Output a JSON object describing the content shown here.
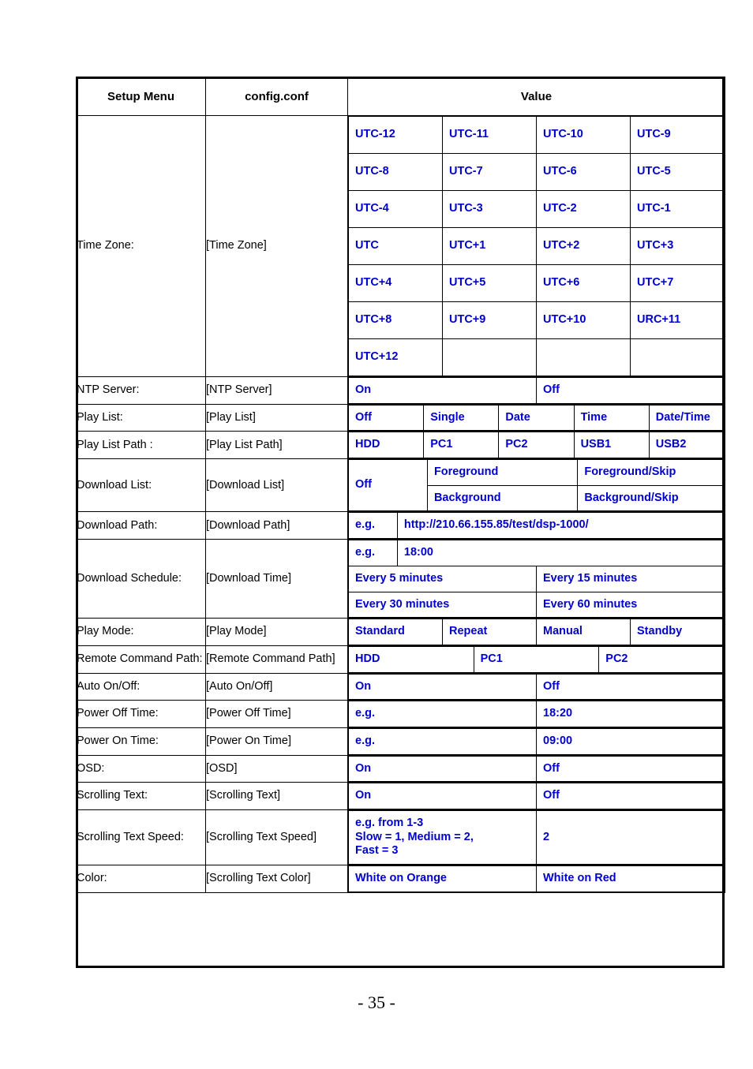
{
  "page": {
    "footer": "- 35 -"
  },
  "table": {
    "headers": {
      "setup_menu": "Setup Menu",
      "config_conf": "config.conf",
      "value": "Value"
    },
    "rows": {
      "time_zone": {
        "label": "Time Zone:",
        "conf": "[Time Zone]",
        "values": [
          [
            "UTC-12",
            "UTC-11",
            "UTC-10",
            "UTC-9"
          ],
          [
            "UTC-8",
            "UTC-7",
            "UTC-6",
            "UTC-5"
          ],
          [
            "UTC-4",
            "UTC-3",
            "UTC-2",
            "UTC-1"
          ],
          [
            "UTC",
            "UTC+1",
            "UTC+2",
            "UTC+3"
          ],
          [
            "UTC+4",
            "UTC+5",
            "UTC+6",
            "UTC+7"
          ],
          [
            "UTC+8",
            "UTC+9",
            "UTC+10",
            "URC+11"
          ],
          [
            "UTC+12",
            "",
            "",
            ""
          ]
        ]
      },
      "ntp_server": {
        "label": "NTP Server:",
        "conf": "[NTP Server]",
        "option_on": "On",
        "option_off": "Off"
      },
      "play_list": {
        "label": "Play List:",
        "conf": "[Play List]",
        "options": [
          "Off",
          "Single",
          "Date",
          "Time",
          "Date/Time"
        ]
      },
      "play_list_path": {
        "label": "Play List Path :",
        "conf": "[Play List Path]",
        "options": [
          "HDD",
          "PC1",
          "PC2",
          "USB1",
          "USB2"
        ]
      },
      "download_list": {
        "label": "Download List:",
        "conf": "[Download List]",
        "option_off": "Off",
        "option_foreground": "Foreground",
        "option_foreground_skip": "Foreground/Skip",
        "option_background": "Background",
        "option_background_skip": "Background/Skip"
      },
      "download_path": {
        "label": "Download Path:",
        "conf": "[Download Path]",
        "eg_label": "e.g.",
        "eg_value": "http://210.66.155.85/test/dsp-1000/"
      },
      "download_schedule": {
        "label": "Download Schedule:",
        "conf": "[Download Time]",
        "eg_label": "e.g.",
        "eg_value": "18:00",
        "option_5": "Every 5 minutes",
        "option_15": "Every 15 minutes",
        "option_30": "Every 30 minutes",
        "option_60": "Every 60 minutes"
      },
      "play_mode": {
        "label": "Play Mode:",
        "conf": "[Play Mode]",
        "options": [
          "Standard",
          "Repeat",
          "Manual",
          "Standby"
        ]
      },
      "remote_command_path": {
        "label": "Remote Command Path:",
        "conf": "[Remote Command Path]",
        "options": [
          "HDD",
          "PC1",
          "PC2"
        ]
      },
      "auto_on_off": {
        "label": "Auto On/Off:",
        "conf": "[Auto On/Off]",
        "option_on": "On",
        "option_off": "Off"
      },
      "power_off_time": {
        "label": "Power Off Time:",
        "conf": "[Power Off Time]",
        "eg_label": "e.g.",
        "eg_value": "18:20"
      },
      "power_on_time": {
        "label": "Power On Time:",
        "conf": "[Power On Time]",
        "eg_label": "e.g.",
        "eg_value": "09:00"
      },
      "osd": {
        "label": "OSD:",
        "conf": "[OSD]",
        "option_on": "On",
        "option_off": "Off"
      },
      "scrolling_text": {
        "label": "Scrolling Text:",
        "conf": "[Scrolling Text]",
        "option_on": "On",
        "option_off": "Off"
      },
      "scrolling_text_speed": {
        "label": "Scrolling Text Speed:",
        "conf": "[Scrolling Text Speed]",
        "eg_label": "e.g. from 1-3\nSlow = 1, Medium = 2,\nFast = 3",
        "eg_value": "2"
      },
      "color": {
        "label": "Color:",
        "conf": "[Scrolling Text Color]",
        "option_orange": "White on Orange",
        "option_red": "White on Red"
      }
    }
  },
  "colors": {
    "option_blue": "#0000CC",
    "example_red": "#FF0000",
    "border": "#000000"
  }
}
